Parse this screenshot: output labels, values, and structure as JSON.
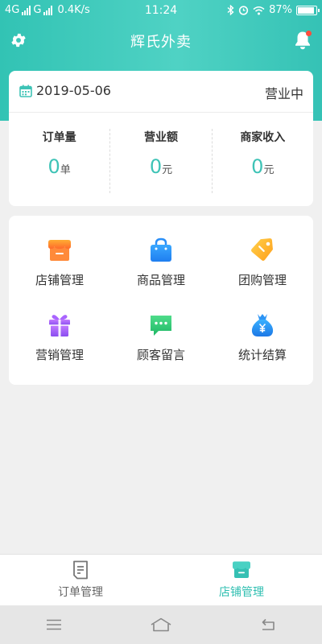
{
  "status_bar": {
    "network_1": "4G",
    "network_2": "G",
    "speed": "0.4K/s",
    "time": "11:24",
    "battery": "87%",
    "icons": [
      "bluetooth-icon",
      "alarm-icon",
      "wifi-icon",
      "battery-icon"
    ]
  },
  "header": {
    "title": "辉氏外卖",
    "left_icon": "gear-icon",
    "right_icon": "bell-icon"
  },
  "summary": {
    "date": "2019-05-06",
    "status": "营业中",
    "stats": [
      {
        "label": "订单量",
        "value": "0",
        "unit": "单"
      },
      {
        "label": "营业额",
        "value": "0",
        "unit": "元"
      },
      {
        "label": "商家收入",
        "value": "0",
        "unit": "元"
      }
    ]
  },
  "features": [
    {
      "label": "店铺管理",
      "icon": "store-icon"
    },
    {
      "label": "商品管理",
      "icon": "shopping-bag-icon"
    },
    {
      "label": "团购管理",
      "icon": "tag-icon"
    },
    {
      "label": "营销管理",
      "icon": "gift-icon"
    },
    {
      "label": "顾客留言",
      "icon": "message-icon"
    },
    {
      "label": "统计结算",
      "icon": "money-bag-icon"
    }
  ],
  "tabs": [
    {
      "label": "订单管理",
      "icon": "order-document-icon",
      "active": false
    },
    {
      "label": "店铺管理",
      "icon": "store-icon",
      "active": true
    }
  ],
  "colors": {
    "accent": "#3ec3b6",
    "header_gradient_start": "#32c3b4",
    "header_gradient_end": "#4fd2c4",
    "notification_dot": "#ff4d3d"
  }
}
